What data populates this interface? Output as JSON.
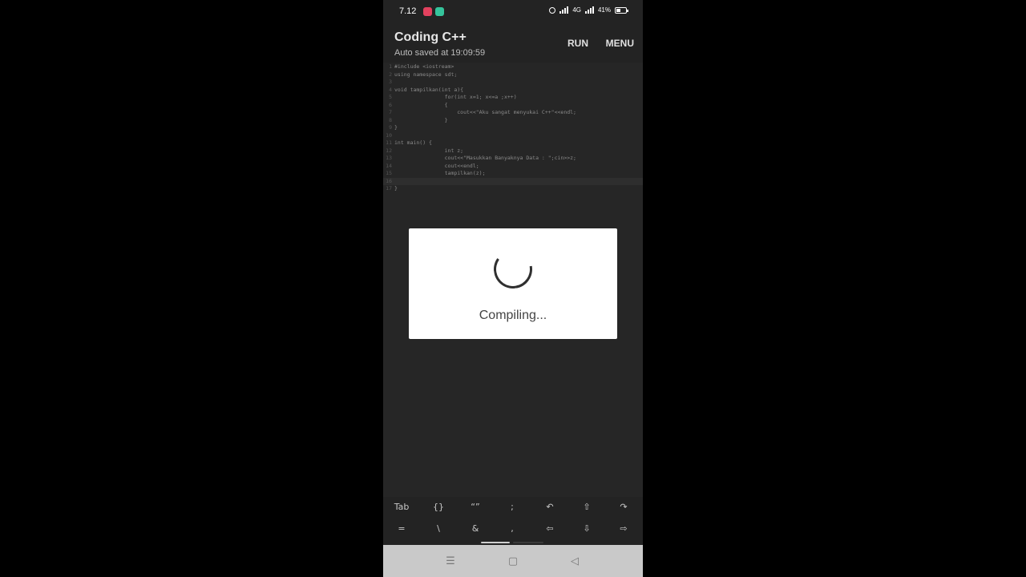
{
  "status_bar": {
    "time": "7.12",
    "network": "4G",
    "battery_percent": "41%",
    "battery_level": 0.41
  },
  "app_bar": {
    "title": "Coding C++",
    "subtitle": "Auto saved at 19:09:59",
    "run_label": "RUN",
    "menu_label": "MENU"
  },
  "editor": {
    "lines": [
      {
        "n": "1",
        "text": "#include <iostream>"
      },
      {
        "n": "2",
        "text": "using namespace sdt;"
      },
      {
        "n": "3",
        "text": ""
      },
      {
        "n": "4",
        "text": "void tampilkan(int a){"
      },
      {
        "n": "5",
        "text": "                for(int x=1; x<=a ;x++)"
      },
      {
        "n": "6",
        "text": "                {"
      },
      {
        "n": "7",
        "text": "                    cout<<\"Aku sangat menyukai C++\"<<endl;"
      },
      {
        "n": "8",
        "text": "                }"
      },
      {
        "n": "9",
        "text": "}"
      },
      {
        "n": "10",
        "text": ""
      },
      {
        "n": "11",
        "text": "int main() {"
      },
      {
        "n": "12",
        "text": "                int z;"
      },
      {
        "n": "13",
        "text": "                cout<<\"Masukkan Banyaknya Data : \";cin>>z;"
      },
      {
        "n": "14",
        "text": "                cout<<endl;"
      },
      {
        "n": "15",
        "text": "                tampilkan(z);"
      },
      {
        "n": "16",
        "text": ""
      },
      {
        "n": "17",
        "text": "}"
      }
    ],
    "active_line": 16
  },
  "dialog": {
    "message": "Compiling..."
  },
  "keyboard": {
    "row1": [
      "Tab",
      "{}",
      "“”",
      ";",
      "↶",
      "⇧",
      "↷"
    ],
    "row2": [
      "=",
      "\\",
      "&",
      ",",
      "⇦",
      "⇩",
      "⇨"
    ]
  },
  "nav_bar": {
    "recents": "☰",
    "home": "▢",
    "back": "◁"
  }
}
